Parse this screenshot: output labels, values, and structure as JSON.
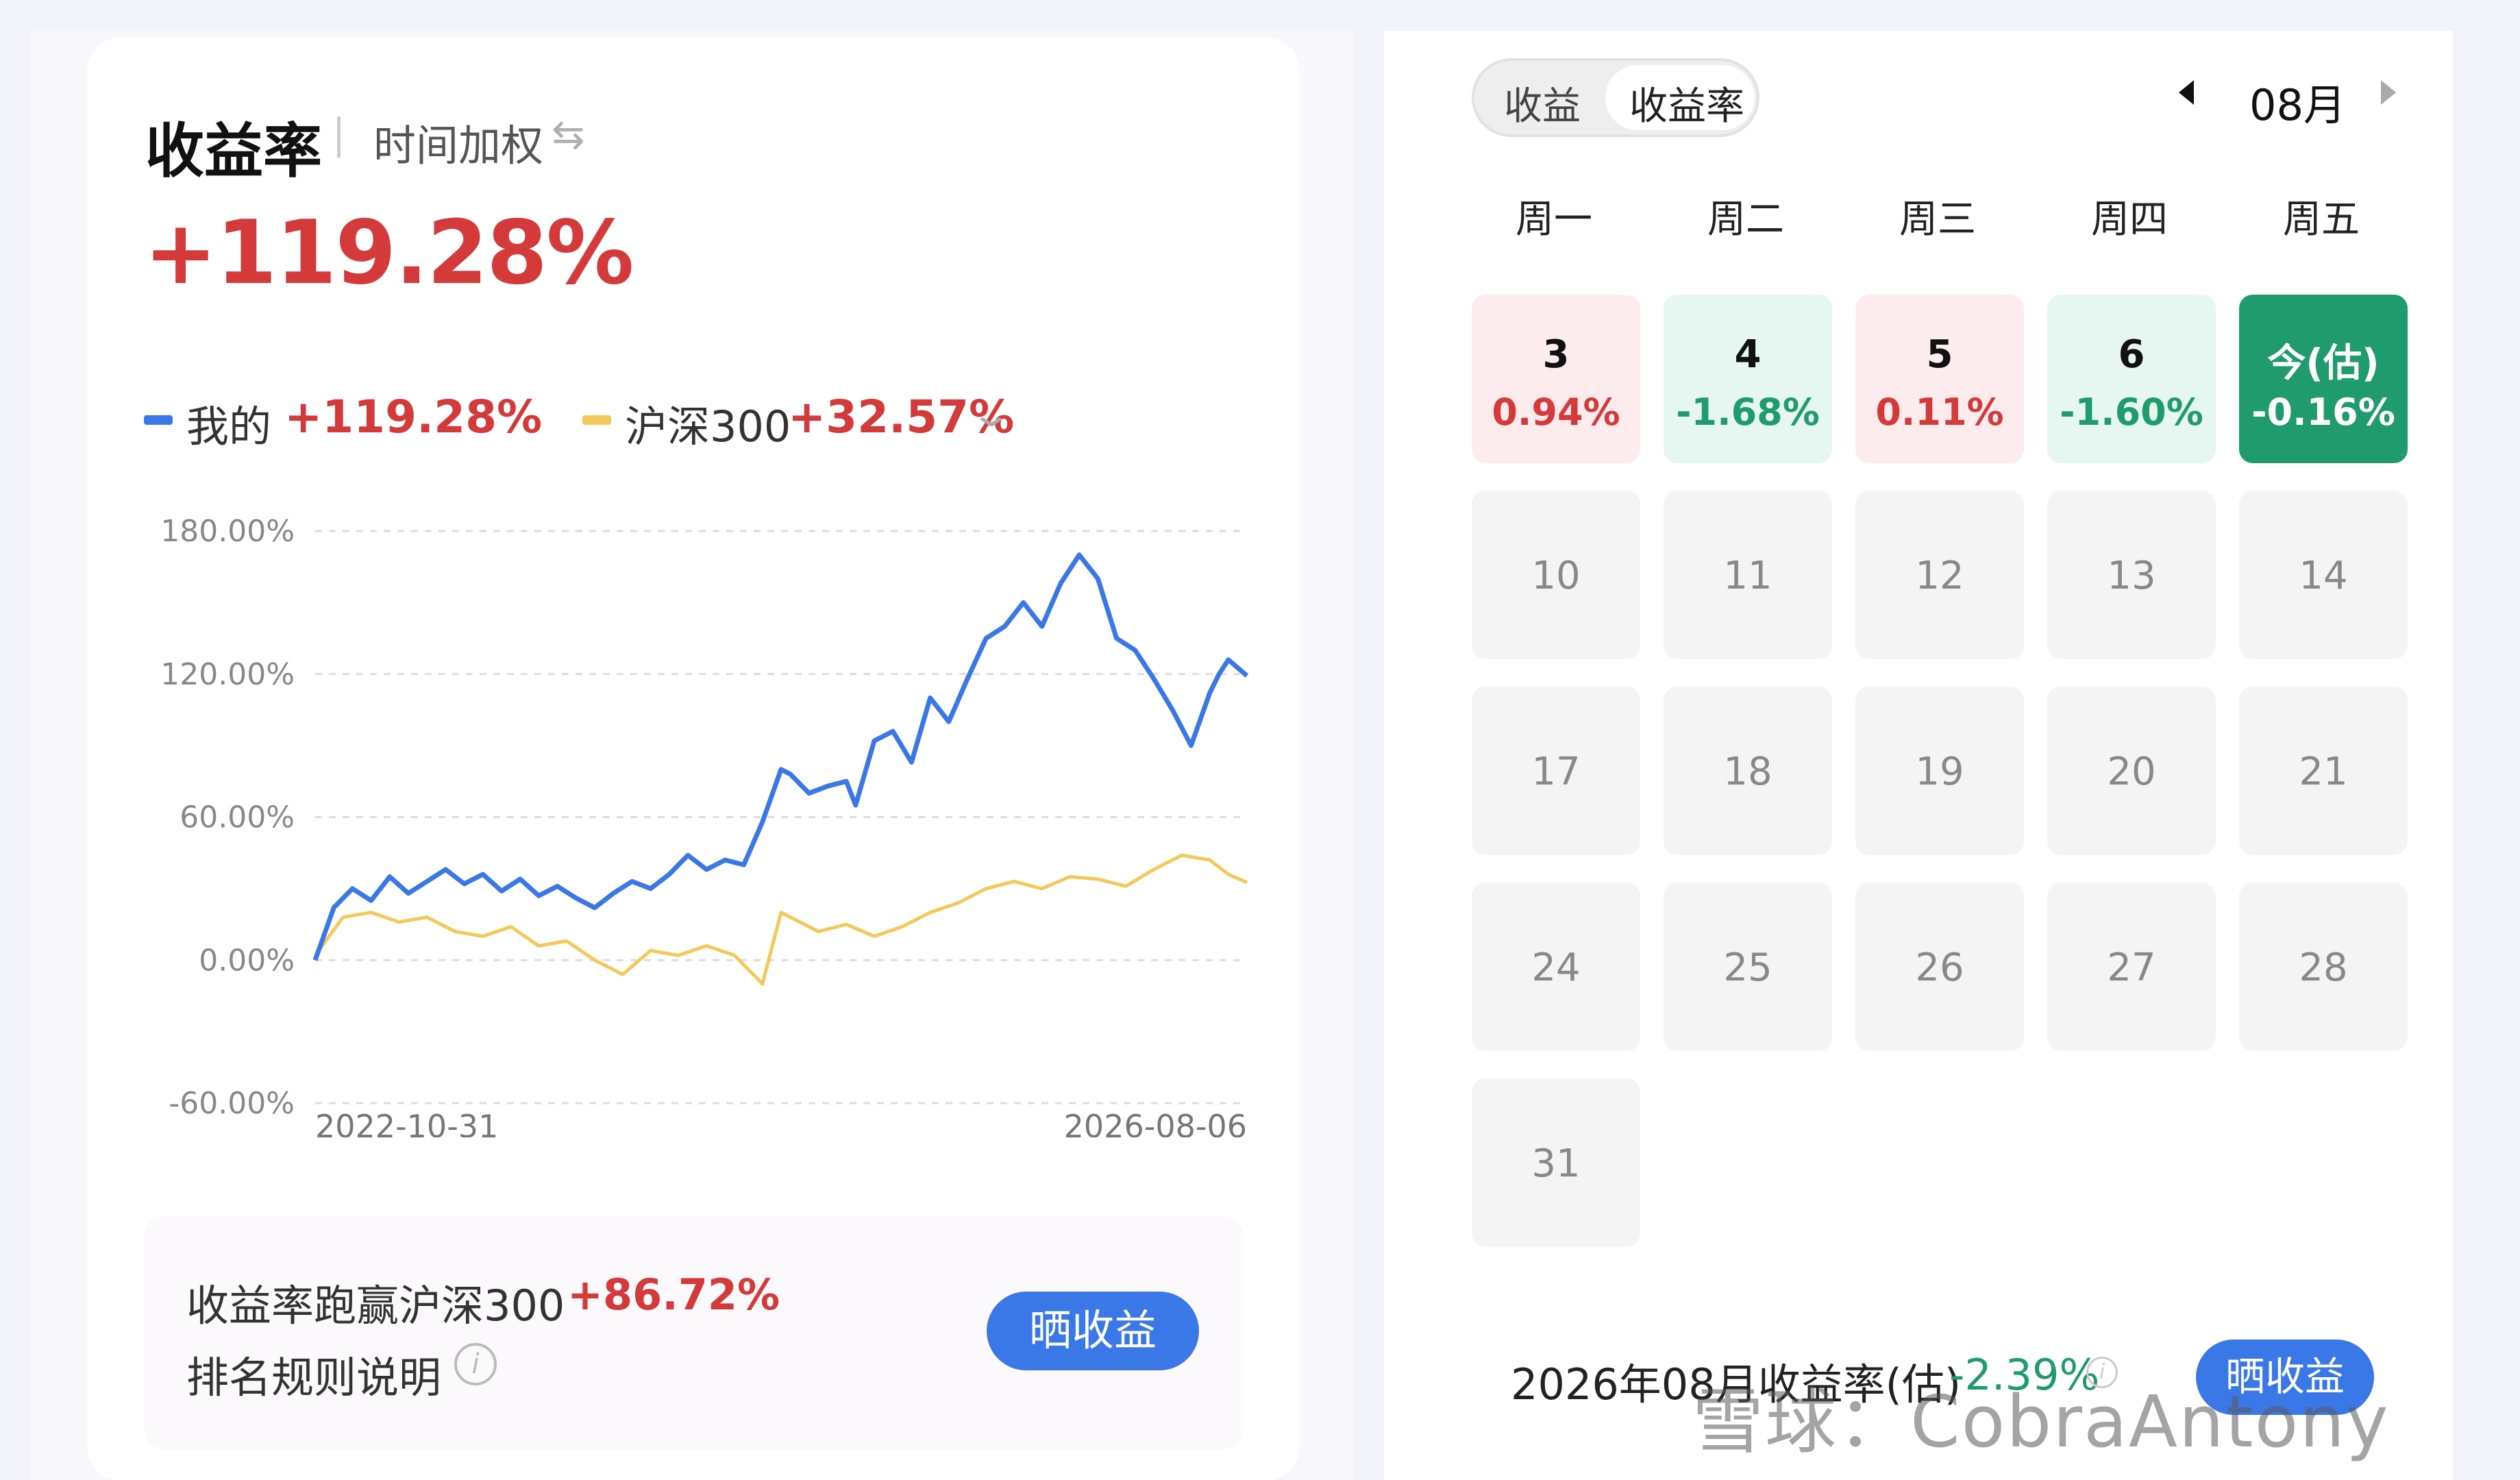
{
  "header": {
    "title": "收益率",
    "mode": "时间加权",
    "swap_icon": "swap-icon",
    "total_return": "+119.28%"
  },
  "legend": {
    "mine_name": "我的",
    "mine_value": "+119.28%",
    "index_name": "沪深300",
    "index_value": "+32.57%",
    "mine_color": "#3b78e7",
    "index_color": "#f5c85a"
  },
  "chart_data": {
    "type": "line",
    "yticks": [
      "180.00%",
      "120.00%",
      "60.00%",
      "0.00%",
      "-60.00%"
    ],
    "ylim": [
      -60,
      180
    ],
    "x_start_label": "2022-10-31",
    "x_end_label": "2026-08-06",
    "series": [
      {
        "name": "我的",
        "color": "#3b78e7",
        "x": [
          0,
          2,
          4,
          6,
          8,
          10,
          12,
          14,
          16,
          18,
          20,
          22,
          24,
          26,
          28,
          30,
          32,
          34,
          36,
          38,
          40,
          42,
          44,
          46,
          48,
          50,
          51,
          53,
          55,
          57,
          58,
          60,
          62,
          64,
          66,
          68,
          70,
          72,
          74,
          76,
          78,
          80,
          82,
          84,
          86,
          88,
          89,
          90,
          92,
          94,
          96,
          97,
          98,
          100
        ],
        "values": [
          0,
          22,
          30,
          25,
          35,
          28,
          33,
          38,
          32,
          36,
          29,
          34,
          27,
          31,
          26,
          22,
          28,
          33,
          30,
          36,
          44,
          38,
          42,
          40,
          58,
          80,
          78,
          70,
          73,
          75,
          65,
          92,
          96,
          83,
          110,
          100,
          118,
          135,
          140,
          150,
          140,
          158,
          170,
          160,
          135,
          130,
          124,
          118,
          105,
          90,
          112,
          120,
          126,
          119.28
        ]
      },
      {
        "name": "沪深300",
        "color": "#f5c85a",
        "x": [
          0,
          3,
          6,
          9,
          12,
          15,
          18,
          21,
          24,
          27,
          30,
          33,
          36,
          39,
          42,
          45,
          48,
          50,
          51,
          54,
          57,
          60,
          63,
          66,
          69,
          72,
          75,
          78,
          81,
          84,
          87,
          90,
          93,
          96,
          98,
          100
        ],
        "values": [
          2,
          18,
          20,
          16,
          18,
          12,
          10,
          14,
          6,
          8,
          0,
          -6,
          4,
          2,
          6,
          2,
          -10,
          20,
          18,
          12,
          15,
          10,
          14,
          20,
          24,
          30,
          33,
          30,
          35,
          34,
          31,
          38,
          44,
          42,
          36,
          32.57
        ]
      }
    ]
  },
  "compare": {
    "text": "收益率跑赢沪深300",
    "value": "+86.72%",
    "rule_text": "排名规则说明",
    "share_label": "晒收益"
  },
  "calendar": {
    "toggle_profit": "收益",
    "toggle_rate": "收益率",
    "month": "08月",
    "weekdays": [
      "周一",
      "周二",
      "周三",
      "周四",
      "周五"
    ],
    "week1": [
      {
        "day": "3",
        "pct": "0.94%"
      },
      {
        "day": "4",
        "pct": "-1.68%"
      },
      {
        "day": "5",
        "pct": "0.11%"
      },
      {
        "day": "6",
        "pct": "-1.60%"
      },
      {
        "day": "今(估)",
        "pct": "-0.16%"
      }
    ],
    "days": {
      "d10": "10",
      "d11": "11",
      "d12": "12",
      "d13": "13",
      "d14": "14",
      "d17": "17",
      "d18": "18",
      "d19": "19",
      "d20": "20",
      "d21": "21",
      "d24": "24",
      "d25": "25",
      "d26": "26",
      "d27": "27",
      "d28": "28",
      "d31": "31"
    },
    "up_color": "#d43a3a",
    "down_color": "#1f9b6d"
  },
  "month_summary": {
    "text": "2026年08月收益率(估)",
    "value": "-2.39%",
    "share_label": "晒收益"
  },
  "watermark": "雪球：CobraAntony"
}
